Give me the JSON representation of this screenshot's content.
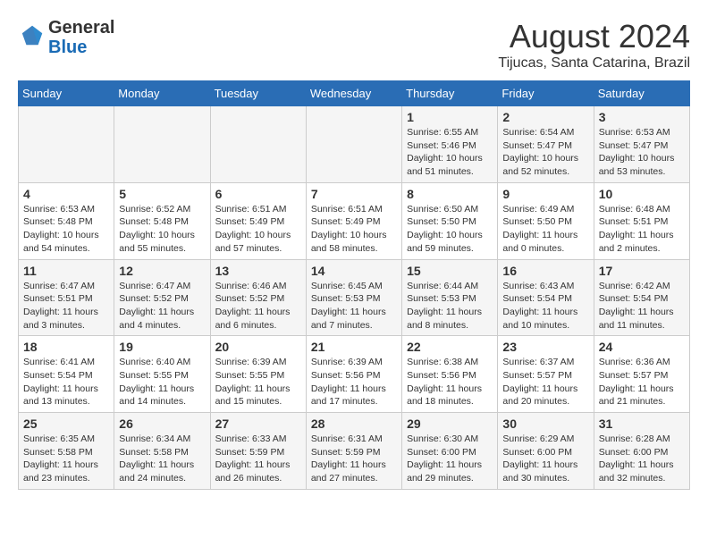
{
  "header": {
    "logo_line1": "General",
    "logo_line2": "Blue",
    "main_title": "August 2024",
    "subtitle": "Tijucas, Santa Catarina, Brazil"
  },
  "days_of_week": [
    "Sunday",
    "Monday",
    "Tuesday",
    "Wednesday",
    "Thursday",
    "Friday",
    "Saturday"
  ],
  "weeks": [
    [
      {
        "day": "",
        "info": ""
      },
      {
        "day": "",
        "info": ""
      },
      {
        "day": "",
        "info": ""
      },
      {
        "day": "",
        "info": ""
      },
      {
        "day": "1",
        "info": "Sunrise: 6:55 AM\nSunset: 5:46 PM\nDaylight: 10 hours\nand 51 minutes."
      },
      {
        "day": "2",
        "info": "Sunrise: 6:54 AM\nSunset: 5:47 PM\nDaylight: 10 hours\nand 52 minutes."
      },
      {
        "day": "3",
        "info": "Sunrise: 6:53 AM\nSunset: 5:47 PM\nDaylight: 10 hours\nand 53 minutes."
      }
    ],
    [
      {
        "day": "4",
        "info": "Sunrise: 6:53 AM\nSunset: 5:48 PM\nDaylight: 10 hours\nand 54 minutes."
      },
      {
        "day": "5",
        "info": "Sunrise: 6:52 AM\nSunset: 5:48 PM\nDaylight: 10 hours\nand 55 minutes."
      },
      {
        "day": "6",
        "info": "Sunrise: 6:51 AM\nSunset: 5:49 PM\nDaylight: 10 hours\nand 57 minutes."
      },
      {
        "day": "7",
        "info": "Sunrise: 6:51 AM\nSunset: 5:49 PM\nDaylight: 10 hours\nand 58 minutes."
      },
      {
        "day": "8",
        "info": "Sunrise: 6:50 AM\nSunset: 5:50 PM\nDaylight: 10 hours\nand 59 minutes."
      },
      {
        "day": "9",
        "info": "Sunrise: 6:49 AM\nSunset: 5:50 PM\nDaylight: 11 hours\nand 0 minutes."
      },
      {
        "day": "10",
        "info": "Sunrise: 6:48 AM\nSunset: 5:51 PM\nDaylight: 11 hours\nand 2 minutes."
      }
    ],
    [
      {
        "day": "11",
        "info": "Sunrise: 6:47 AM\nSunset: 5:51 PM\nDaylight: 11 hours\nand 3 minutes."
      },
      {
        "day": "12",
        "info": "Sunrise: 6:47 AM\nSunset: 5:52 PM\nDaylight: 11 hours\nand 4 minutes."
      },
      {
        "day": "13",
        "info": "Sunrise: 6:46 AM\nSunset: 5:52 PM\nDaylight: 11 hours\nand 6 minutes."
      },
      {
        "day": "14",
        "info": "Sunrise: 6:45 AM\nSunset: 5:53 PM\nDaylight: 11 hours\nand 7 minutes."
      },
      {
        "day": "15",
        "info": "Sunrise: 6:44 AM\nSunset: 5:53 PM\nDaylight: 11 hours\nand 8 minutes."
      },
      {
        "day": "16",
        "info": "Sunrise: 6:43 AM\nSunset: 5:54 PM\nDaylight: 11 hours\nand 10 minutes."
      },
      {
        "day": "17",
        "info": "Sunrise: 6:42 AM\nSunset: 5:54 PM\nDaylight: 11 hours\nand 11 minutes."
      }
    ],
    [
      {
        "day": "18",
        "info": "Sunrise: 6:41 AM\nSunset: 5:54 PM\nDaylight: 11 hours\nand 13 minutes."
      },
      {
        "day": "19",
        "info": "Sunrise: 6:40 AM\nSunset: 5:55 PM\nDaylight: 11 hours\nand 14 minutes."
      },
      {
        "day": "20",
        "info": "Sunrise: 6:39 AM\nSunset: 5:55 PM\nDaylight: 11 hours\nand 15 minutes."
      },
      {
        "day": "21",
        "info": "Sunrise: 6:39 AM\nSunset: 5:56 PM\nDaylight: 11 hours\nand 17 minutes."
      },
      {
        "day": "22",
        "info": "Sunrise: 6:38 AM\nSunset: 5:56 PM\nDaylight: 11 hours\nand 18 minutes."
      },
      {
        "day": "23",
        "info": "Sunrise: 6:37 AM\nSunset: 5:57 PM\nDaylight: 11 hours\nand 20 minutes."
      },
      {
        "day": "24",
        "info": "Sunrise: 6:36 AM\nSunset: 5:57 PM\nDaylight: 11 hours\nand 21 minutes."
      }
    ],
    [
      {
        "day": "25",
        "info": "Sunrise: 6:35 AM\nSunset: 5:58 PM\nDaylight: 11 hours\nand 23 minutes."
      },
      {
        "day": "26",
        "info": "Sunrise: 6:34 AM\nSunset: 5:58 PM\nDaylight: 11 hours\nand 24 minutes."
      },
      {
        "day": "27",
        "info": "Sunrise: 6:33 AM\nSunset: 5:59 PM\nDaylight: 11 hours\nand 26 minutes."
      },
      {
        "day": "28",
        "info": "Sunrise: 6:31 AM\nSunset: 5:59 PM\nDaylight: 11 hours\nand 27 minutes."
      },
      {
        "day": "29",
        "info": "Sunrise: 6:30 AM\nSunset: 6:00 PM\nDaylight: 11 hours\nand 29 minutes."
      },
      {
        "day": "30",
        "info": "Sunrise: 6:29 AM\nSunset: 6:00 PM\nDaylight: 11 hours\nand 30 minutes."
      },
      {
        "day": "31",
        "info": "Sunrise: 6:28 AM\nSunset: 6:00 PM\nDaylight: 11 hours\nand 32 minutes."
      }
    ]
  ]
}
